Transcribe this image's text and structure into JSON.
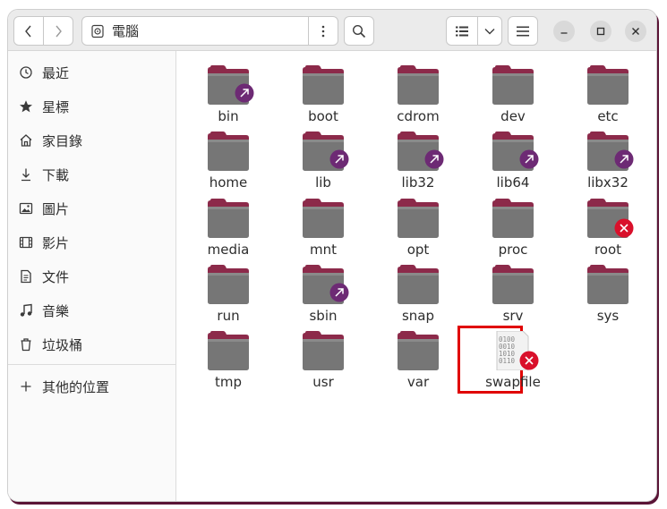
{
  "window": {
    "path_location": "電腦",
    "icons": {
      "back": "chevron-left-icon",
      "forward": "chevron-right-icon",
      "location": "disk-icon",
      "path_menu": "vertical-dots-icon",
      "search": "search-icon",
      "view": "list-view-icon",
      "view_dropdown": "chevron-down-icon",
      "main_menu": "hamburger-menu-icon",
      "minimize": "minimize-icon",
      "maximize": "maximize-icon",
      "close": "close-icon"
    }
  },
  "sidebar": {
    "items": [
      {
        "label": "最近",
        "icon": "recent-clock-icon"
      },
      {
        "label": "星標",
        "icon": "star-icon"
      },
      {
        "label": "家目錄",
        "icon": "home-icon"
      },
      {
        "label": "下載",
        "icon": "download-icon"
      },
      {
        "label": "圖片",
        "icon": "image-icon"
      },
      {
        "label": "影片",
        "icon": "video-icon"
      },
      {
        "label": "文件",
        "icon": "document-icon"
      },
      {
        "label": "音樂",
        "icon": "music-icon"
      },
      {
        "label": "垃圾桶",
        "icon": "trash-icon"
      }
    ],
    "other_locations": {
      "label": "其他的位置",
      "icon": "plus-icon"
    }
  },
  "files": [
    {
      "name": "bin",
      "type": "folder",
      "badge": "link"
    },
    {
      "name": "boot",
      "type": "folder",
      "badge": null
    },
    {
      "name": "cdrom",
      "type": "folder",
      "badge": null
    },
    {
      "name": "dev",
      "type": "folder",
      "badge": null
    },
    {
      "name": "etc",
      "type": "folder",
      "badge": null
    },
    {
      "name": "home",
      "type": "folder",
      "badge": null
    },
    {
      "name": "lib",
      "type": "folder",
      "badge": "link"
    },
    {
      "name": "lib32",
      "type": "folder",
      "badge": "link"
    },
    {
      "name": "lib64",
      "type": "folder",
      "badge": "link"
    },
    {
      "name": "libx32",
      "type": "folder",
      "badge": "link"
    },
    {
      "name": "media",
      "type": "folder",
      "badge": null
    },
    {
      "name": "mnt",
      "type": "folder",
      "badge": null
    },
    {
      "name": "opt",
      "type": "folder",
      "badge": null
    },
    {
      "name": "proc",
      "type": "folder",
      "badge": null
    },
    {
      "name": "root",
      "type": "folder",
      "badge": "no-access"
    },
    {
      "name": "run",
      "type": "folder",
      "badge": null
    },
    {
      "name": "sbin",
      "type": "folder",
      "badge": "link"
    },
    {
      "name": "snap",
      "type": "folder",
      "badge": null
    },
    {
      "name": "srv",
      "type": "folder",
      "badge": null
    },
    {
      "name": "sys",
      "type": "folder",
      "badge": null
    },
    {
      "name": "tmp",
      "type": "folder",
      "badge": null
    },
    {
      "name": "usr",
      "type": "folder",
      "badge": null,
      "highlighted": true
    },
    {
      "name": "var",
      "type": "folder",
      "badge": null
    },
    {
      "name": "swapfile",
      "type": "binary-file",
      "badge": "no-access",
      "file_glyph": "0100\n0010\n1010\n0110"
    }
  ],
  "colors": {
    "folder_tab": "#8c2a4a",
    "folder_body": "#767676",
    "link_badge": "#6d2a74",
    "no_access_badge": "#d9102b",
    "highlight": "#e00000",
    "window_shadow": "#5a1436"
  }
}
